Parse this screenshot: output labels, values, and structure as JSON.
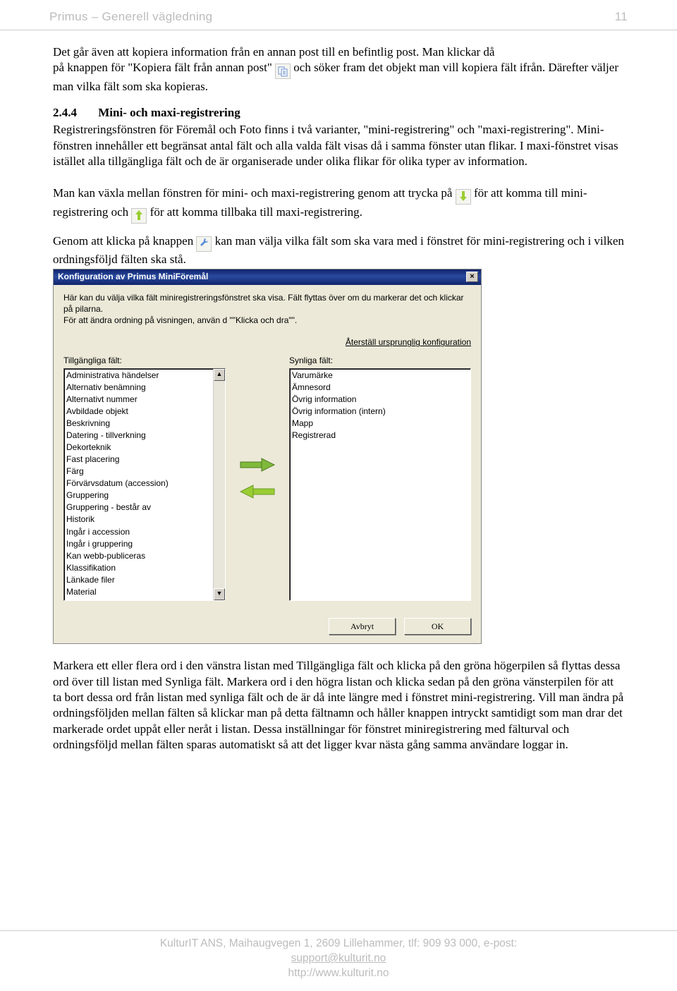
{
  "header": {
    "title": "Primus – Generell vägledning",
    "page": "11"
  },
  "body": {
    "p1a": "Det går även att kopiera information från en annan post till en befintlig post. Man klickar då",
    "p1b": "på knappen för \"Kopiera fält från annan post\" ",
    "p1c": " och söker fram det objekt man vill kopiera fält ifrån. Därefter väljer man vilka fält som ska kopieras.",
    "sect_num": "2.4.4",
    "sect_title": "Mini- och maxi-registrering",
    "p2": "Registreringsfönstren för Föremål och Foto finns i två varianter, \"mini-registrering\" och \"maxi-registrering\". Mini-fönstren innehåller ett begränsat antal fält och alla valda fält visas då i samma fönster utan flikar. I maxi-fönstret visas istället alla tillgängliga fält och de är organiserade under olika flikar för olika typer av information.",
    "p3a": "Man kan växla mellan fönstren för mini- och maxi-registrering genom att trycka på ",
    "p3b": " för att komma till mini-registrering och ",
    "p3c": " för att komma tillbaka till maxi-registrering.",
    "p4a": "Genom att klicka på knappen ",
    "p4b": " kan man välja vilka fält som ska vara med i fönstret för mini-registrering och i vilken ordningsföljd fälten ska stå.",
    "p5": "Markera ett eller flera ord i den vänstra listan med Tillgängliga fält och klicka på den gröna högerpilen så flyttas dessa ord över till listan med Synliga fält. Markera ord i den högra listan och klicka sedan på den gröna vänsterpilen för att ta bort dessa ord från listan med synliga fält och de är då inte längre med i fönstret mini-registrering. Vill man ändra på ordningsföljden mellan fälten så klickar man på detta fältnamn och håller knappen intryckt samtidigt som man drar det markerade ordet uppåt eller neråt i listan. Dessa inställningar för fönstret miniregistrering med fälturval och ordningsföljd mellan fälten sparas automatiskt så att det ligger kvar nästa gång samma användare loggar in."
  },
  "dialog": {
    "title": "Konfiguration av Primus MiniFöremål",
    "intro1": "Här kan du välja vilka fält miniregistreringsfönstret ska visa. Fält flyttas över om du markerar det och klickar på pilarna.",
    "intro2": "För att ändra ordning på visningen, använ d \"\"Klicka och dra\"\".",
    "reset": "Återställ ursprunglig konfiguration",
    "left_label": "Tillgängliga fält:",
    "right_label": "Synliga fält:",
    "available": [
      "Administrativa händelser",
      "Alternativ benämning",
      "Alternativt nummer",
      "Avbildade objekt",
      "Beskrivning",
      "Datering - tillverkning",
      "Dekorteknik",
      "Fast placering",
      "Färg",
      "Förvärvsdatum (accession)",
      "Gruppering",
      "Gruppering - består av",
      "Historik",
      "Ingår i accession",
      "Ingår i gruppering",
      "Kan webb-publiceras",
      "Klassifikation",
      "Länkade filer",
      "Material"
    ],
    "visible": [
      "Varumärke",
      "Ämnesord",
      "Övrig information",
      "Övrig information (intern)",
      "Mapp",
      "Registrerad"
    ],
    "cancel": "Avbryt",
    "ok": "OK"
  },
  "footer": {
    "line1": "KulturIT ANS, Maihaugvegen 1, 2609 Lillehammer, tlf: 909 93 000, e-post:",
    "email": "support@kulturit.no",
    "url": "http://www.kulturit.no"
  }
}
